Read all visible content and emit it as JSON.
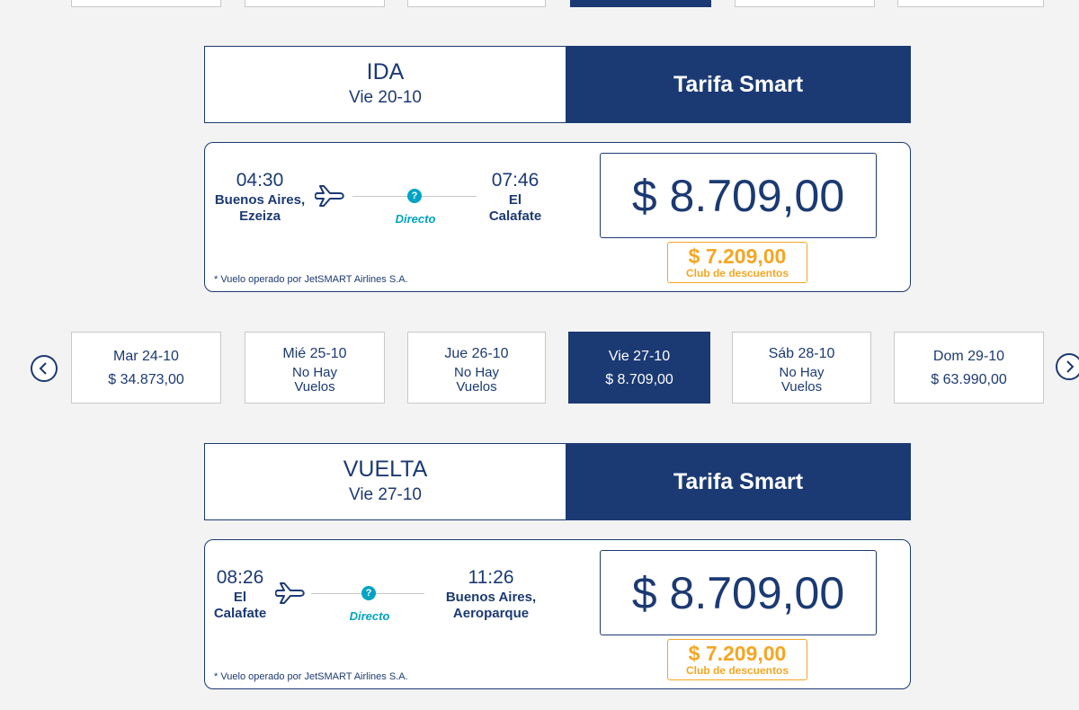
{
  "outbound": {
    "direction": "IDA",
    "date": "Vie 20-10",
    "fare_name": "Tarifa Smart",
    "flight": {
      "depart_time": "04:30",
      "depart_city_line1": "Buenos Aires,",
      "depart_city_line2": "Ezeiza",
      "arrive_time": "07:46",
      "arrive_city_line1": "El",
      "arrive_city_line2": "Calafate",
      "stops_label": "Directo",
      "info_icon": "?",
      "operated_by": "* Vuelo operado por JetSMART Airlines S.A.",
      "price": "$ 8.709,00",
      "club_price": "$ 7.209,00",
      "club_label": "Club de descuentos"
    }
  },
  "date_strip": {
    "items": [
      {
        "label": "Mar 24-10",
        "value": "$ 34.873,00"
      },
      {
        "label": "Mié 25-10",
        "line1": "No Hay",
        "line2": "Vuelos"
      },
      {
        "label": "Jue 26-10",
        "line1": "No Hay",
        "line2": "Vuelos"
      },
      {
        "label": "Vie 27-10",
        "value": "$ 8.709,00",
        "selected": true
      },
      {
        "label": "Sáb 28-10",
        "line1": "No Hay",
        "line2": "Vuelos"
      },
      {
        "label": "Dom 29-10",
        "value": "$ 63.990,00"
      }
    ],
    "prev_icon": "chevron-left-icon",
    "next_icon": "chevron-right-icon"
  },
  "return": {
    "direction": "VUELTA",
    "date": "Vie 27-10",
    "fare_name": "Tarifa Smart",
    "flight": {
      "depart_time": "08:26",
      "depart_city_line1": "El",
      "depart_city_line2": "Calafate",
      "arrive_time": "11:26",
      "arrive_city_line1": "Buenos Aires,",
      "arrive_city_line2": "Aeroparque",
      "stops_label": "Directo",
      "info_icon": "?",
      "operated_by": "* Vuelo operado por JetSMART Airlines S.A.",
      "price": "$ 8.709,00",
      "club_price": "$ 7.209,00",
      "club_label": "Club de descuentos"
    }
  },
  "colors": {
    "navy": "#1b3a73",
    "accent_cyan": "#00a3c4",
    "club_orange": "#f5a623",
    "background": "#f3f3f3"
  }
}
